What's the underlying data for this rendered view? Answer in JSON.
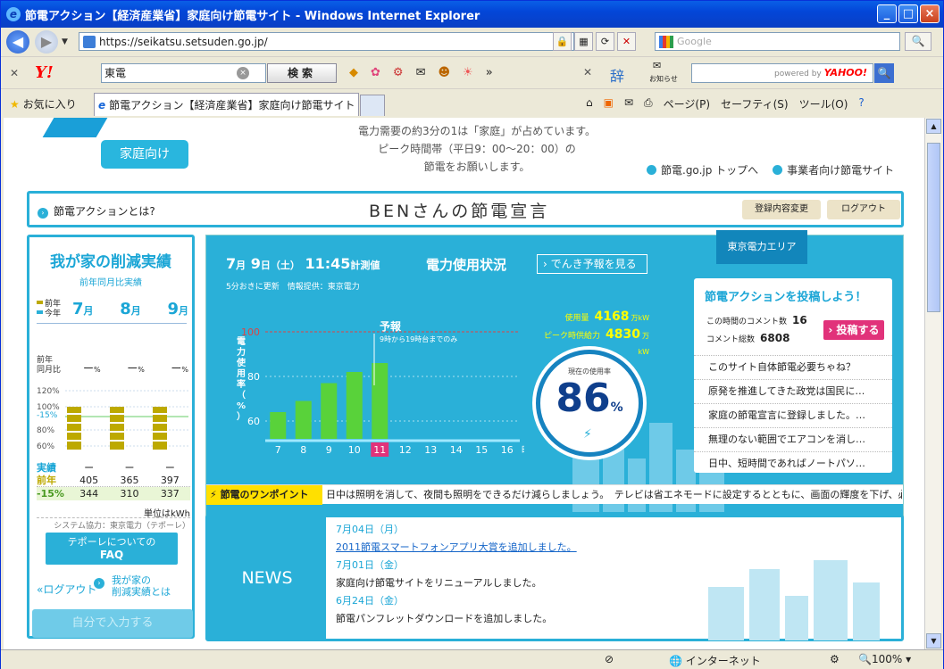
{
  "window": {
    "title": "節電アクション【経済産業省】家庭向け節電サイト - Windows Internet Explorer",
    "buttons": [
      "_",
      "□",
      "×"
    ]
  },
  "browser": {
    "address": "https://seikatsu.setsuden.go.jp/",
    "search_placeholder": "Google",
    "yahoo_query": "東電",
    "yahoo_search_btn": "検索",
    "favorites": "お気に入り",
    "tab_title": "節電アクション【経済産業省】家庭向け節電サイト",
    "commands": [
      "ページ(P)",
      "セーフティ(S)",
      "ツール(O)"
    ],
    "notify": "お知らせ",
    "yahoo_powered": "powered by",
    "yahoo_logo": "YAHOO!",
    "status_zone": "インターネット",
    "zoom": "100%"
  },
  "page": {
    "katei": "家庭向け",
    "intro": [
      "電力需要の約3分の1は「家庭」が占めています。",
      "ピーク時間帯（平日9：00～20：00）の",
      "節電をお願いします。"
    ],
    "toplinks": [
      "節電.go.jp トップへ",
      "事業者向け節電サイト"
    ],
    "declare": {
      "what": "節電アクションとは?",
      "title": "BENさんの節電宣言",
      "btn_change": "登録内容変更",
      "btn_logout": "ログアウト"
    }
  },
  "left": {
    "title": "我が家の削減実績",
    "subtitle": "前年同月比実績",
    "legend": [
      "前年",
      "今年"
    ],
    "months": [
      {
        "n": "7",
        "u": "月"
      },
      {
        "n": "8",
        "u": "月"
      },
      {
        "n": "9",
        "u": "月"
      }
    ],
    "cmp_label": [
      "前年",
      "同月比"
    ],
    "cmp_values": [
      "ー",
      "ー",
      "ー"
    ],
    "cmp_unit": "%",
    "mini_levels": [
      "120%",
      "100%",
      "-15%",
      "80%",
      "60%"
    ],
    "rows": [
      {
        "h": "実績",
        "v": [
          "ー",
          "ー",
          "ー"
        ]
      },
      {
        "h": "前年",
        "v": [
          "405",
          "365",
          "397"
        ]
      },
      {
        "h": "-15%",
        "v": [
          "344",
          "310",
          "337"
        ]
      }
    ],
    "unit": "単位はkWh",
    "coop": "システム協力：東京電力（テポーレ）",
    "faq": [
      "テポーレについての",
      "FAQ"
    ],
    "logout": "ログアウト",
    "jisseki": [
      "我が家の",
      "削減実績とは"
    ],
    "self_input": "自分で入力する"
  },
  "main": {
    "date": {
      "m": "7",
      "mu": "月",
      "d": "9",
      "du": "日（土）",
      "t": "11:45",
      "tu": "計測値"
    },
    "status": "電力使用状況",
    "yohou_btn": "でんき予報を見る",
    "updated": "5分おきに更新　情報提供：東京電力",
    "area": "東京電力エリア",
    "usage": {
      "label": "使用量",
      "value": "4168",
      "unit": "万kW"
    },
    "supply": {
      "label": "ピーク時供給力",
      "value": "4830",
      "unit": "万kW"
    },
    "rate": {
      "label": "現在の使用率",
      "value": "86",
      "unit": "%"
    },
    "forecast": {
      "title": "予報",
      "note": "9時から19時台までのみ"
    }
  },
  "chart_data": {
    "type": "bar",
    "title": "",
    "ylabel": "電力使用率（%）",
    "xlabel": "",
    "x": [
      7,
      8,
      9,
      10,
      11,
      12,
      13,
      14,
      15,
      16
    ],
    "x_unit": "時",
    "values": [
      64,
      69,
      77,
      82,
      86,
      null,
      null,
      null,
      null,
      null
    ],
    "current_hour": 11,
    "yticks": [
      60,
      80,
      100
    ],
    "ylim": [
      52,
      104
    ],
    "reference_line": 100,
    "grid": true,
    "legend": "none",
    "bar_color": "#59d23a",
    "highlight_color": "#e1327a"
  },
  "post": {
    "title": "節電アクションを投稿しよう！",
    "cmt_hour_label": "この時間のコメント数",
    "cmt_hour": "16",
    "cmt_total_label": "コメント総数",
    "cmt_total": "6808",
    "btn": "投稿する",
    "items": [
      "このサイト自体節電必要ちゃね？",
      "原発を推進してきた政党は国民に…",
      "家庭の節電宣言に登録しました。…",
      "無理のない範囲でエアコンを消し…",
      "日中、短時間であればノートパソ…"
    ]
  },
  "ticker": {
    "label": "節電のワンポイント",
    "text": "日中は照明を消して、夜間も照明をできるだけ減らしましょう。　テレビは省エネモードに設定するとともに、画面の輝度を下げ、必"
  },
  "news": {
    "label": "NEWS",
    "items": [
      {
        "date": "7月04日（月）",
        "text": "2011節電スマートフォンアプリ大賞を追加しました。",
        "link": true
      },
      {
        "date": "7月01日（金）",
        "text": "家庭向け節電サイトをリニューアルしました。",
        "link": false
      },
      {
        "date": "6月24日（金）",
        "text": "節電パンフレットダウンロードを追加しました。",
        "link": false
      }
    ]
  }
}
